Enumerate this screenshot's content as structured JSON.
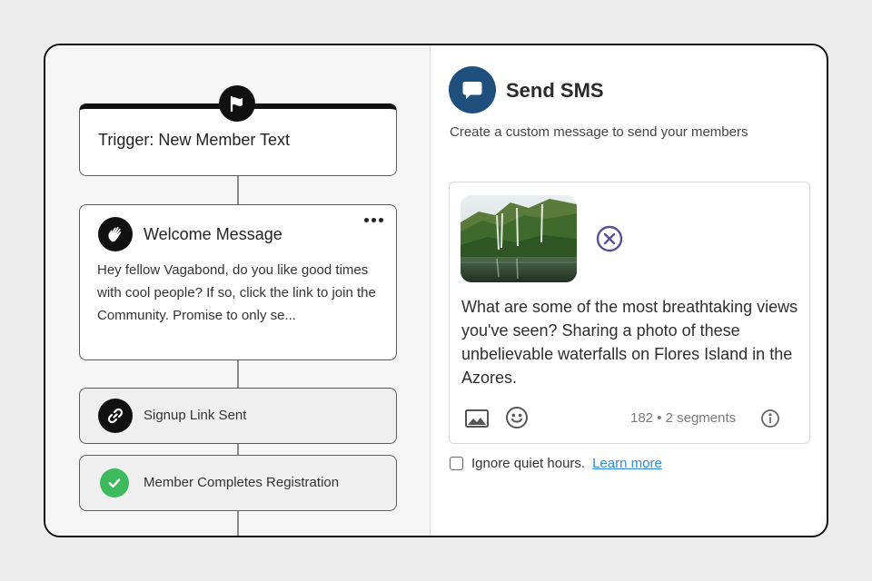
{
  "workflow": {
    "trigger": {
      "title": "Trigger: New Member Text",
      "icon": "flag-icon"
    },
    "welcome": {
      "title": "Welcome Message",
      "icon": "wave-hand-icon",
      "body": "Hey fellow Vagabond, do you like good times with cool people? If so, click the link to join the Community. Promise to only se..."
    },
    "steps": [
      {
        "label": "Signup Link Sent",
        "icon": "link-icon"
      },
      {
        "label": "Member Completes Registration",
        "icon": "check-circle-icon",
        "status_color": "#3dba5e"
      }
    ]
  },
  "panel": {
    "title": "Send SMS",
    "icon": "chat-bubble-icon",
    "accent": "#1f4f7d",
    "subtitle": "Create a custom message to send your members",
    "message": {
      "attachment": "waterfall-photo",
      "text": "What are some of the most breathtaking views you've seen? Sharing a photo of these unbelievable waterfalls on Flores Island in the Azores.",
      "segment_info": "182 • 2 segments"
    },
    "quiet_hours": {
      "label": "Ignore quiet hours.",
      "checked": false
    },
    "learn_more": "Learn more",
    "link_color": "#2a8fd8"
  }
}
